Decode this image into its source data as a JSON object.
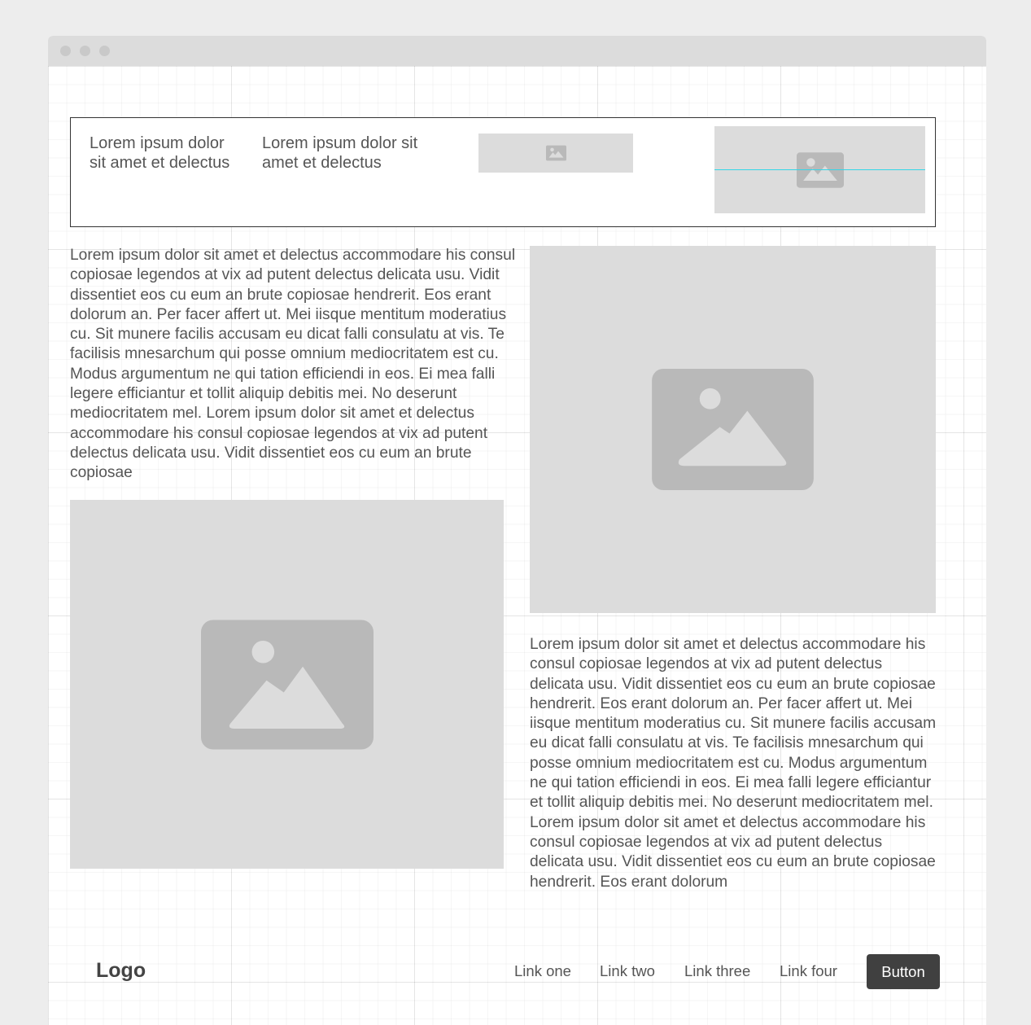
{
  "window": {
    "controls": [
      "close",
      "minimize",
      "maximize"
    ]
  },
  "header": {
    "text_one": "Lorem ipsum dolor sit amet et delectus",
    "text_two": "Lorem ipsum dolor sit amet et delectus",
    "image_small_icon": "image-icon",
    "image_large_icon": "image-icon"
  },
  "section_one": {
    "paragraph": "Lorem ipsum dolor sit amet et delectus accommodare his consul copiosae legendos at vix ad putent delectus delicata usu. Vidit dissentiet eos cu eum an brute copiosae hendrerit. Eos erant dolorum an. Per facer affert ut. Mei iisque mentitum moderatius cu. Sit munere facilis accusam eu dicat falli consulatu at vis. Te facilisis mnesarchum qui posse omnium mediocritatem est cu. Modus argumentum ne qui tation efficiendi in eos. Ei mea falli legere efficiantur et tollit aliquip debitis mei. No deserunt mediocritatem mel. Lorem ipsum dolor sit amet et delectus accommodare his consul copiosae legendos at vix ad putent delectus delicata usu. Vidit dissentiet eos cu eum an brute copiosae",
    "image_icon": "image-icon"
  },
  "section_two": {
    "paragraph": "Lorem ipsum dolor sit amet et delectus accommodare his consul copiosae legendos at vix ad putent delectus delicata usu. Vidit dissentiet eos cu eum an brute copiosae hendrerit. Eos erant dolorum an. Per facer affert ut. Mei iisque mentitum moderatius cu. Sit munere facilis accusam eu dicat falli consulatu at vis. Te facilisis mnesarchum qui posse omnium mediocritatem est cu. Modus argumentum ne qui tation efficiendi in eos. Ei mea falli legere efficiantur et tollit aliquip debitis mei. No deserunt mediocritatem mel. Lorem ipsum dolor sit amet et delectus accommodare his consul copiosae legendos at vix ad putent delectus delicata usu. Vidit dissentiet eos cu eum an brute copiosae hendrerit. Eos erant dolorum",
    "image_icon": "image-icon"
  },
  "footer_nav": {
    "logo": "Logo",
    "links": [
      "Link one",
      "Link two",
      "Link three",
      "Link four"
    ],
    "button_label": "Button"
  },
  "colors": {
    "placeholder_bg": "#dcdcdc",
    "placeholder_icon": "#b9b9b9",
    "button_bg": "#404040",
    "guide_line": "#33d6e8"
  }
}
